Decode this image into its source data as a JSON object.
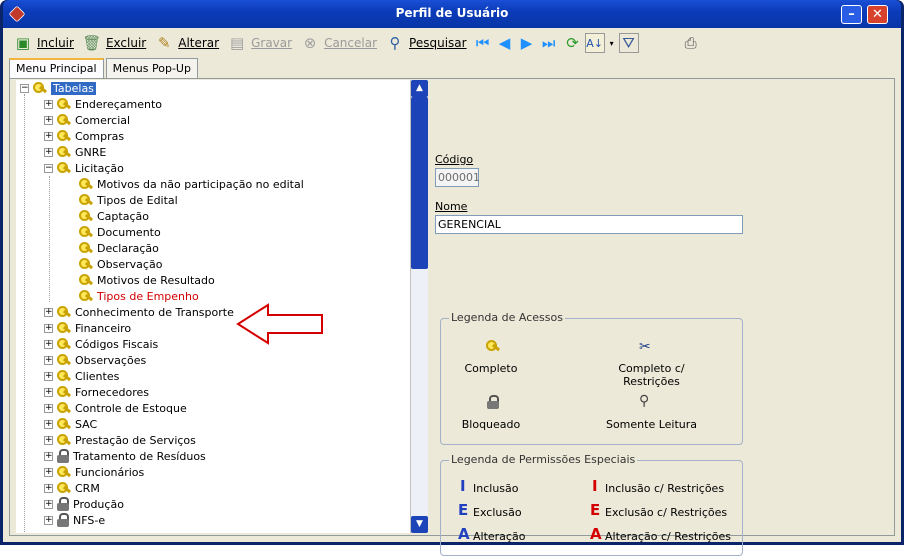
{
  "window": {
    "title": "Perfil de Usuário"
  },
  "toolbar": {
    "incluir": "Incluir",
    "excluir": "Excluir",
    "alterar": "Alterar",
    "gravar": "Gravar",
    "cancelar": "Cancelar",
    "pesquisar": "Pesquisar"
  },
  "tabs": [
    "Menu Principal",
    "Menus Pop-Up"
  ],
  "tree": {
    "root": "Tabelas",
    "items": [
      "Endereçamento",
      "Comercial",
      "Compras",
      "GNRE",
      "Licitação",
      "Motivos da não participação no edital",
      "Tipos de Edital",
      "Captação",
      "Documento",
      "Declaração",
      "Observação",
      "Motivos de Resultado",
      "Tipos de Empenho",
      "Conhecimento de Transporte",
      "Financeiro",
      "Códigos Fiscais",
      "Observações",
      "Clientes",
      "Fornecedores",
      "Controle de Estoque",
      "SAC",
      "Prestação de Serviços",
      "Tratamento de Resíduos",
      "Funcionários",
      "CRM",
      "Produção",
      "NFS-e"
    ]
  },
  "form": {
    "codigo_label": "Código",
    "codigo_value": "000001",
    "nome_label": "Nome",
    "nome_value": "GERENCIAL"
  },
  "legend_access": {
    "title": "Legenda de Acessos",
    "completo": "Completo",
    "completo_restricoes": "Completo c/ Restrições",
    "bloqueado": "Bloqueado",
    "somente_leitura": "Somente Leitura"
  },
  "legend_perms": {
    "title": "Legenda de Permissões Especiais",
    "inclusao": "Inclusão",
    "inclusao_r": "Inclusão c/ Restrições",
    "exclusao": "Exclusão",
    "exclusao_r": "Exclusão c/ Restrições",
    "alteracao": "Alteração",
    "alteracao_r": "Alteração c/ Restrições",
    "glyph_i": "I",
    "glyph_e": "E",
    "glyph_a": "A"
  },
  "colors": {
    "title_bar": "#0b3bb8",
    "highlight": "#d40000",
    "selection": "#316ac5",
    "perm_blue": "#2040c0"
  }
}
